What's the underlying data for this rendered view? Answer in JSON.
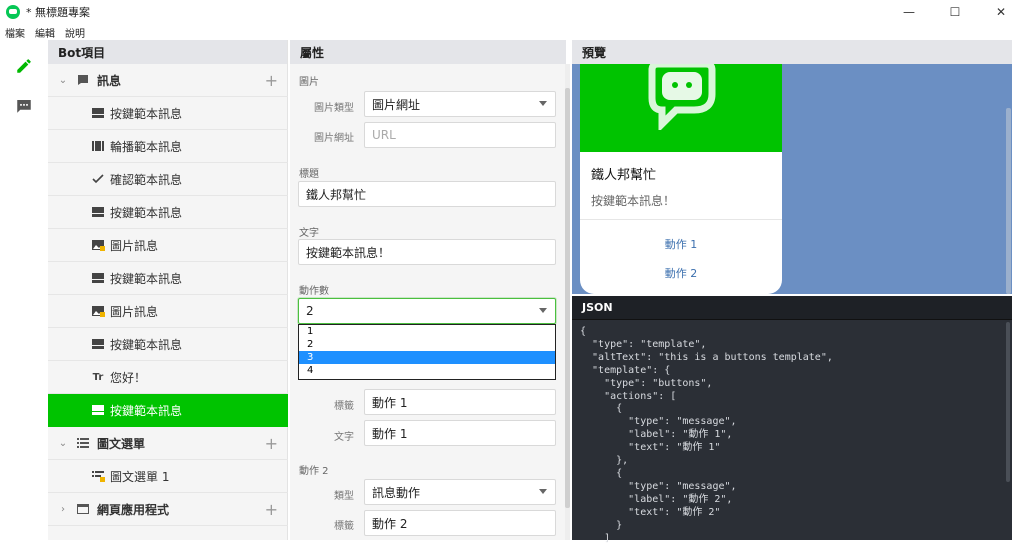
{
  "window": {
    "title": "* 無標題專案",
    "minimize": "—",
    "maximize": "☐",
    "close": "✕"
  },
  "menu": [
    "檔案",
    "編輯",
    "說明"
  ],
  "rail": {
    "edit_icon": "pencil-icon",
    "chat_icon": "chat-icon"
  },
  "bot_panel": {
    "header": "Bot項目",
    "groups": [
      {
        "label": "訊息",
        "icon": "message-icon",
        "expanded": true
      },
      {
        "label": "圖文選單",
        "icon": "list-icon",
        "expanded": true
      },
      {
        "label": "網頁應用程式",
        "icon": "browser-icon",
        "expanded": false
      }
    ],
    "items": [
      "按鍵範本訊息",
      "輪播範本訊息",
      "確認範本訊息",
      "按鍵範本訊息",
      "圖片訊息",
      "按鍵範本訊息",
      "圖片訊息",
      "按鍵範本訊息",
      "您好！",
      "按鍵範本訊息"
    ],
    "richmenu_items": [
      "圖文選單 1"
    ]
  },
  "props": {
    "header": "屬性",
    "image_section": "圖片",
    "image_type_label": "圖片類型",
    "image_type_value": "圖片網址",
    "image_url_label": "圖片網址",
    "image_url_placeholder": "URL",
    "title_section": "標題",
    "title_value": "鐵人邦幫忙",
    "text_section": "文字",
    "text_value": "按鍵範本訊息！",
    "action_count_section": "動作數",
    "action_count_value": "2",
    "action_count_options": [
      "1",
      "2",
      "3",
      "4"
    ],
    "action1_label_label": "標籤",
    "action1_label_value": "動作 1",
    "action1_text_label": "文字",
    "action1_text_value": "動作 1",
    "action2_section": "動作 2",
    "action2_type_label": "類型",
    "action2_type_value": "訊息動作",
    "action2_label_label": "標籤",
    "action2_label_value": "動作 2"
  },
  "preview": {
    "header": "預覽",
    "card_title": "鐵人邦幫忙",
    "card_text": "按鍵範本訊息！",
    "actions": [
      "動作 1",
      "動作 2"
    ]
  },
  "json_panel": {
    "header": "JSON",
    "code": "{\n  \"type\": \"template\",\n  \"altText\": \"this is a buttons template\",\n  \"template\": {\n    \"type\": \"buttons\",\n    \"actions\": [\n      {\n        \"type\": \"message\",\n        \"label\": \"動作 1\",\n        \"text\": \"動作 1\"\n      },\n      {\n        \"type\": \"message\",\n        \"label\": \"動作 2\",\n        \"text\": \"動作 2\"\n      }\n    ]"
  },
  "colors": {
    "accent": "#00c300",
    "preview_bg": "#6b8fc3",
    "json_bg": "#2b2f36",
    "selection": "#1e90ff"
  }
}
